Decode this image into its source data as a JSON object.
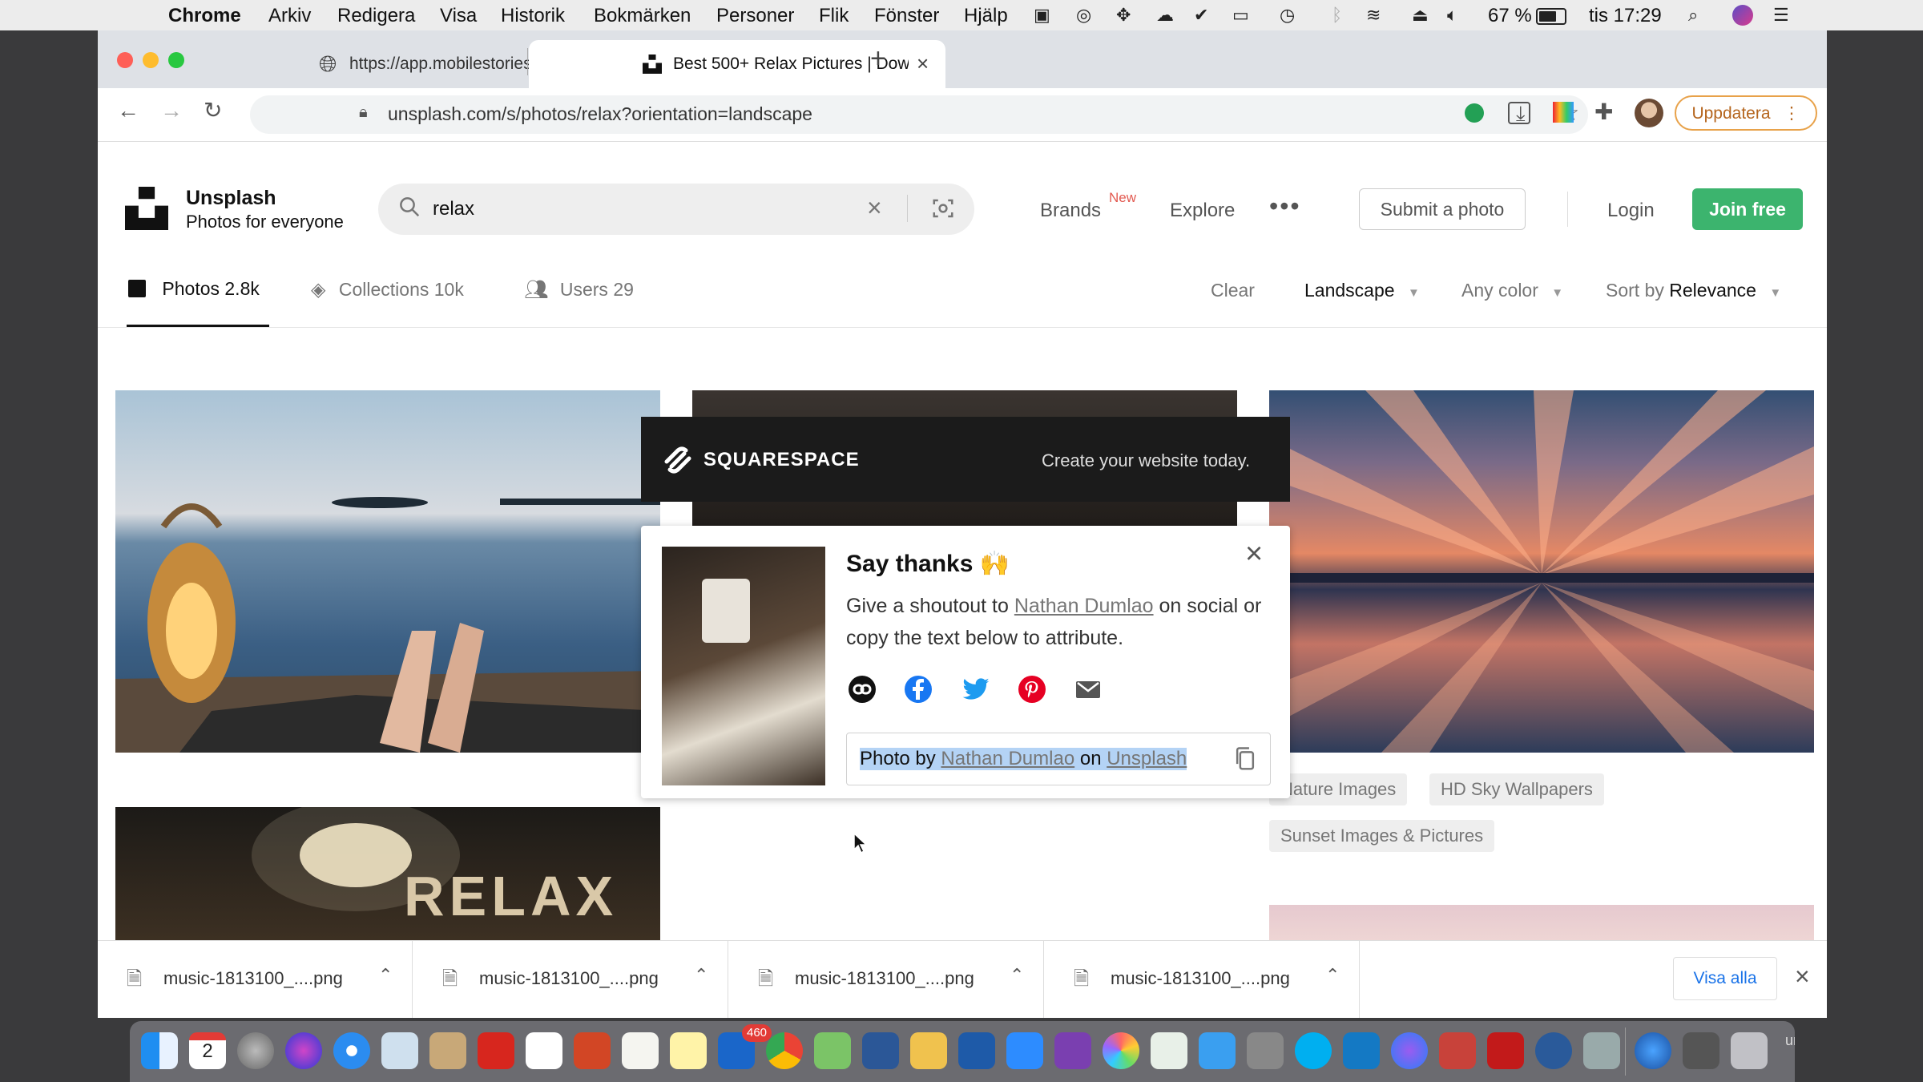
{
  "menubar": {
    "app_name": "Chrome",
    "items": [
      "Arkiv",
      "Redigera",
      "Visa",
      "Historik",
      "Bokmärken",
      "Personer",
      "Flik",
      "Fönster",
      "Hjälp"
    ],
    "battery": "67 %",
    "clock": "tis 17:29"
  },
  "browser": {
    "tabs": [
      {
        "title": "https://app.mobilestories.se/co",
        "active": false
      },
      {
        "title": "Best 500+ Relax Pictures | Dow",
        "active": true
      }
    ],
    "url": "unsplash.com/s/photos/relax?orientation=landscape",
    "update_label": "Uppdatera"
  },
  "header": {
    "brand_name": "Unsplash",
    "brand_tagline": "Photos for everyone",
    "search_value": "relax",
    "nav": {
      "brands": "Brands",
      "brands_badge": "New",
      "explore": "Explore"
    },
    "submit_label": "Submit a photo",
    "login_label": "Login",
    "join_label": "Join free"
  },
  "filters": {
    "tabs": [
      {
        "label": "Photos",
        "count": "2.8k",
        "active": true
      },
      {
        "label": "Collections",
        "count": "10k",
        "active": false
      },
      {
        "label": "Users",
        "count": "29",
        "active": false
      }
    ],
    "clear": "Clear",
    "orientation": "Landscape",
    "color": "Any color",
    "sort_prefix": "Sort by",
    "sort_value": "Relevance"
  },
  "related_chips": [
    "Nature Images",
    "HD Sky Wallpapers",
    "Sunset Images & Pictures"
  ],
  "ad": {
    "brand": "SQUARESPACE",
    "tagline": "Create your website today."
  },
  "dialog": {
    "title": "Say thanks 🙌",
    "text_before": "Give a shoutout to",
    "author": "Nathan Dumlao",
    "text_after": "on social or copy the text below to attribute.",
    "attribution_prefix": "Photo by",
    "attribution_mid": "on",
    "attribution_site": "Unsplash"
  },
  "downloads": {
    "files": [
      "music-1813100_....png",
      "music-1813100_....png",
      "music-1813100_....png",
      "music-1813100_....png"
    ],
    "show_all": "Visa alla"
  },
  "dock": {
    "calendar_day": "2",
    "mail_badge": "460",
    "edge_text": "unta i"
  }
}
